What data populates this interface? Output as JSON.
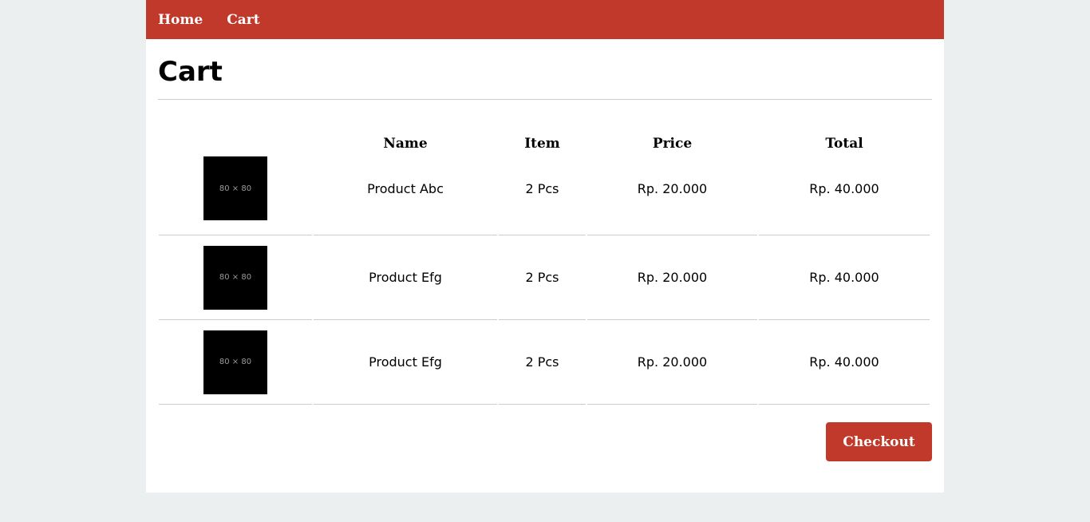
{
  "nav": {
    "home_label": "Home",
    "cart_label": "Cart"
  },
  "page": {
    "title": "Cart"
  },
  "table": {
    "headers": [
      "",
      "Name",
      "Item",
      "Price",
      "Total"
    ],
    "rows": [
      {
        "thumb": "80 × 80",
        "name": "Product Abc",
        "item": "2 Pcs",
        "price": "Rp. 20.000",
        "total": "Rp. 40.000"
      },
      {
        "thumb": "80 × 80",
        "name": "Product Efg",
        "item": "2 Pcs",
        "price": "Rp. 20.000",
        "total": "Rp. 40.000"
      },
      {
        "thumb": "80 × 80",
        "name": "Product Efg",
        "item": "2 Pcs",
        "price": "Rp. 20.000",
        "total": "Rp. 40.000"
      }
    ]
  },
  "actions": {
    "checkout_label": "Checkout"
  },
  "colors": {
    "accent": "#c0392b",
    "background": "#ebeff0",
    "panel": "#ffffff"
  }
}
